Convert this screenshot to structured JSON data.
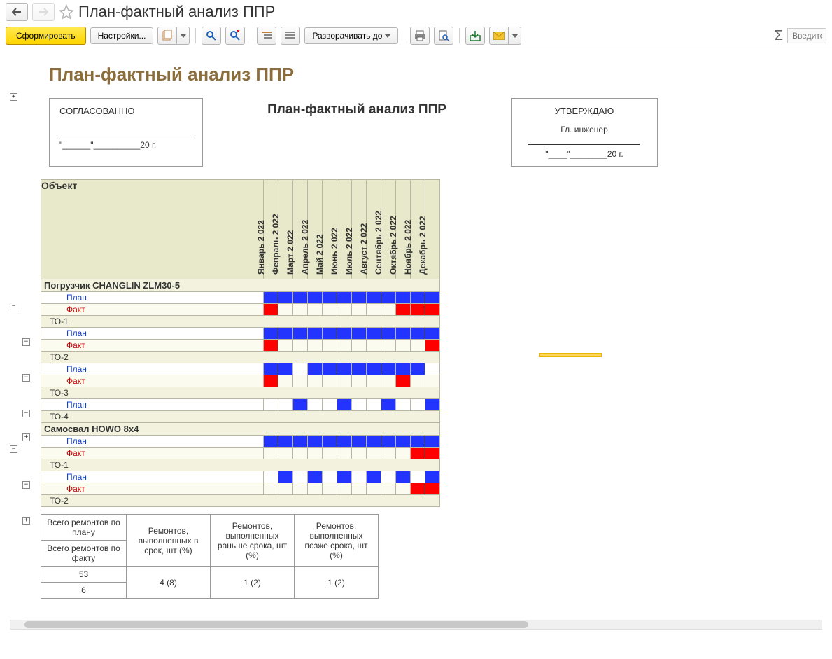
{
  "titlebar": {
    "title": "План-фактный анализ ППР"
  },
  "toolbar": {
    "generate": "Сформировать",
    "settings": "Настройки...",
    "expand_to": "Разворачивать до",
    "search_placeholder": "Введите"
  },
  "report": {
    "title": "План-фактный анализ ППР",
    "doc_title": "План-фактный анализ ППР",
    "agreed": "СОГЛАСОВАННО",
    "agreed_date": "\"______\"__________20    г.",
    "approved": "УТВЕРЖДАЮ",
    "approved_role": "Гл. инженер",
    "approved_date": "\"____\"________20    г.",
    "object_header": "Объект",
    "months": [
      "Январь 2 022",
      "Февраль 2 022",
      "Март 2 022",
      "Апрель 2 022",
      "Май 2 022",
      "Июнь 2 022",
      "Июль 2 022",
      "Август 2 022",
      "Сентябрь 2 022",
      "Октябрь 2 022",
      "Ноябрь 2 022",
      "Декабрь 2 022"
    ],
    "plan_label": "План",
    "fact_label": "Факт",
    "groups": [
      {
        "name": "Погрузчик CHANGLIN ZLM30-5",
        "plan": [
          1,
          1,
          1,
          1,
          1,
          1,
          1,
          1,
          1,
          1,
          1,
          1
        ],
        "fact": [
          2,
          0,
          0,
          0,
          0,
          0,
          0,
          0,
          0,
          2,
          2,
          2
        ],
        "children": [
          {
            "name": "ТО-1",
            "plan": [
              1,
              1,
              1,
              1,
              1,
              1,
              1,
              1,
              1,
              1,
              1,
              1
            ],
            "fact": [
              2,
              0,
              0,
              0,
              0,
              0,
              0,
              0,
              0,
              0,
              0,
              2
            ]
          },
          {
            "name": "ТО-2",
            "plan": [
              1,
              1,
              0,
              1,
              1,
              1,
              1,
              1,
              1,
              1,
              1,
              0
            ],
            "fact": [
              2,
              0,
              0,
              0,
              0,
              0,
              0,
              0,
              0,
              2,
              0,
              0
            ]
          },
          {
            "name": "ТО-3",
            "plan": [
              0,
              0,
              1,
              0,
              0,
              1,
              0,
              0,
              1,
              0,
              0,
              1
            ],
            "fact": null
          },
          {
            "name": "ТО-4",
            "plan": null,
            "fact": null
          }
        ]
      },
      {
        "name": "Самосвал HOWO 8x4",
        "plan": [
          1,
          1,
          1,
          1,
          1,
          1,
          1,
          1,
          1,
          1,
          1,
          1
        ],
        "fact": [
          0,
          0,
          0,
          0,
          0,
          0,
          0,
          0,
          0,
          0,
          2,
          2
        ],
        "children": [
          {
            "name": "ТО-1",
            "plan": [
              0,
              1,
              0,
              1,
              0,
              1,
              0,
              1,
              0,
              1,
              0,
              1
            ],
            "fact": [
              0,
              0,
              0,
              0,
              0,
              0,
              0,
              0,
              0,
              0,
              2,
              2
            ]
          },
          {
            "name": "ТО-2",
            "plan": null,
            "fact": null
          }
        ]
      }
    ]
  },
  "summary": {
    "h_plan": "Всего ремонтов по плану",
    "h_fact": "Всего ремонтов по факту",
    "h_ontime": "Ремонтов, выполненных в срок, шт (%)",
    "h_early": "Ремонтов, выполненных раньше срока, шт (%)",
    "h_late": "Ремонтов, выполненных позже срока, шт (%)",
    "v_plan": "53",
    "v_fact": "6",
    "v_ontime": "4 (8)",
    "v_early": "1 (2)",
    "v_late": "1 (2)"
  }
}
